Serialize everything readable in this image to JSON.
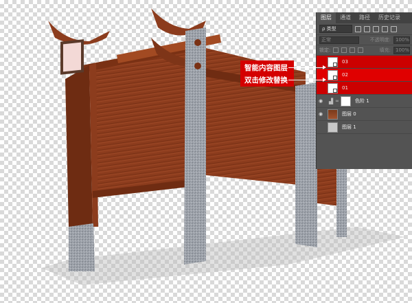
{
  "panel": {
    "tabs": [
      "图层",
      "通道",
      "路径",
      "历史记录"
    ],
    "filter_kind": "ρ 类型",
    "blend_mode": "正常",
    "opacity_label": "不透明度:",
    "opacity_value": "100%",
    "lock_label": "锁定:",
    "fill_label": "填充:",
    "fill_value": "100%",
    "layers": [
      {
        "name": "03",
        "type": "smart",
        "selected": false
      },
      {
        "name": "02",
        "type": "smart",
        "selected": true
      },
      {
        "name": "01",
        "type": "smart",
        "selected": false
      },
      {
        "name": "色阶 1",
        "type": "adjustment"
      },
      {
        "name": "图层 0",
        "type": "photo"
      },
      {
        "name": "图层 1",
        "type": "plain"
      }
    ]
  },
  "callout": {
    "line1": "智能内容图层",
    "line2": "双击修改替换"
  },
  "colors": {
    "accent_red": "#d40000",
    "panel_bg": "#535353",
    "wood": "#8a3a1c",
    "stone": "#9aa0a8"
  }
}
